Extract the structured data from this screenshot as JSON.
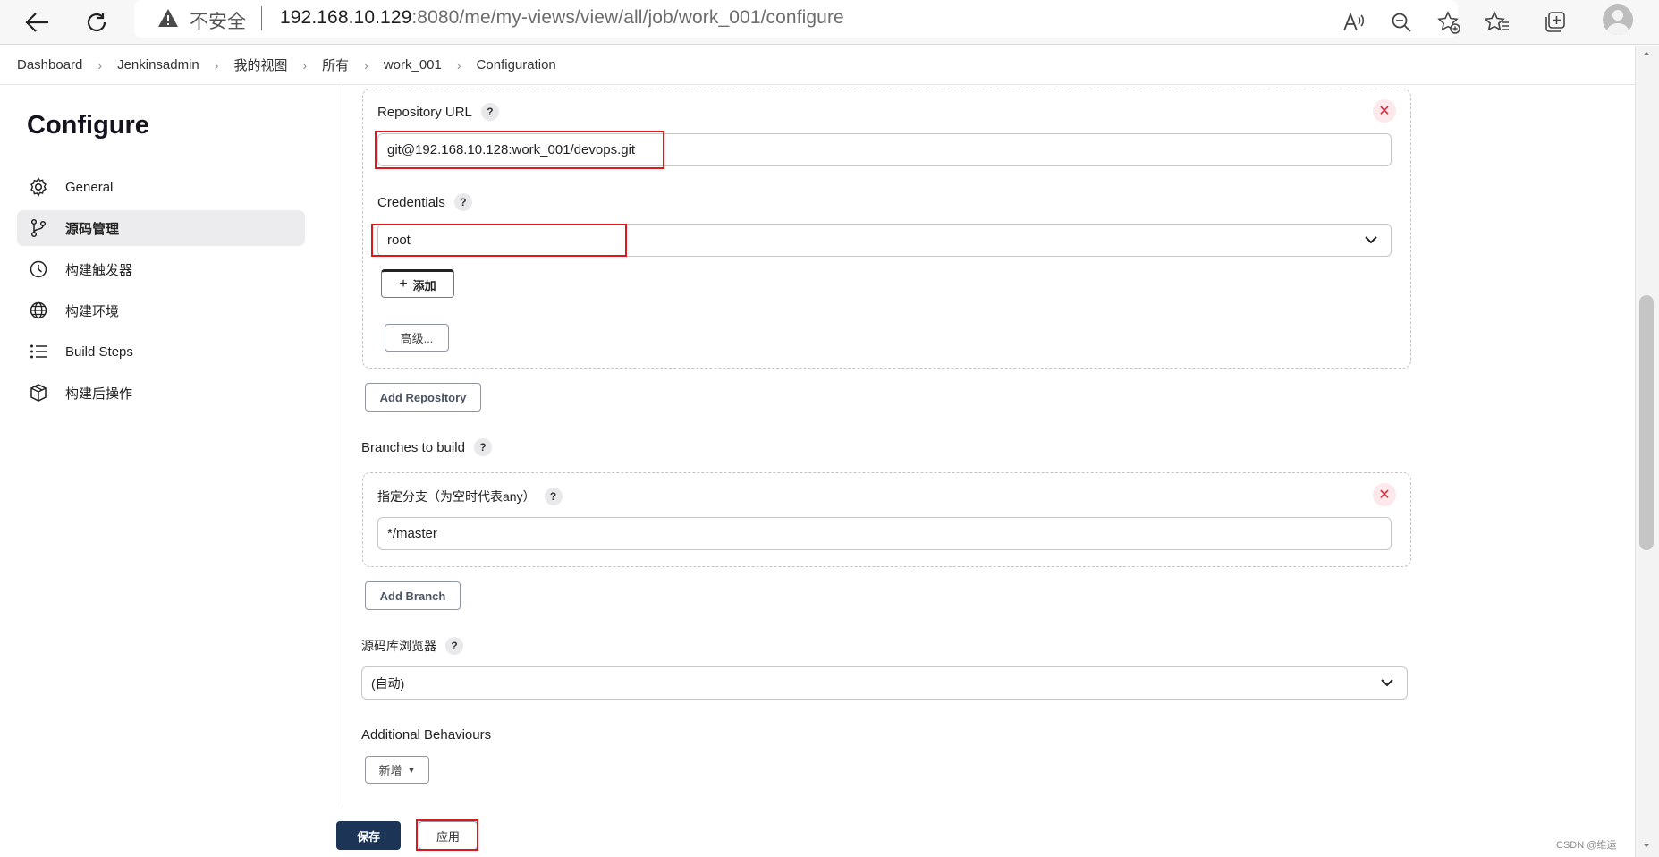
{
  "browser": {
    "insecure_label": "不安全",
    "url_host": "192.168.10.129",
    "url_rest": ":8080/me/my-views/view/all/job/work_001/configure"
  },
  "breadcrumb": [
    "Dashboard",
    "Jenkinsadmin",
    "我的视图",
    "所有",
    "work_001",
    "Configuration"
  ],
  "sidebar": {
    "title": "Configure",
    "items": [
      {
        "label": "General",
        "icon": "gear-icon"
      },
      {
        "label": "源码管理",
        "icon": "branch-icon",
        "active": true
      },
      {
        "label": "构建触发器",
        "icon": "clock-icon"
      },
      {
        "label": "构建环境",
        "icon": "globe-icon"
      },
      {
        "label": "Build Steps",
        "icon": "list-icon"
      },
      {
        "label": "构建后操作",
        "icon": "package-icon"
      }
    ]
  },
  "repository": {
    "url_label": "Repository URL",
    "url_value": "git@192.168.10.128:work_001/devops.git",
    "credentials_label": "Credentials",
    "credentials_value": "root",
    "add_label": "添加",
    "advanced_label": "高级..."
  },
  "add_repository_label": "Add Repository",
  "branches": {
    "label": "Branches to build",
    "specifier_label": "指定分支（为空时代表any）",
    "specifier_value": "*/master",
    "add_branch_label": "Add Branch"
  },
  "browser_field": {
    "label": "源码库浏览器",
    "value": "(自动)"
  },
  "additional": {
    "label": "Additional Behaviours",
    "add_label": "新增"
  },
  "footer": {
    "save_label": "保存",
    "apply_label": "应用"
  },
  "watermark": "CSDN @维运",
  "colors": {
    "highlight": "#e0161d",
    "primary_button": "#1c3557",
    "delete": "#d52a3a"
  }
}
